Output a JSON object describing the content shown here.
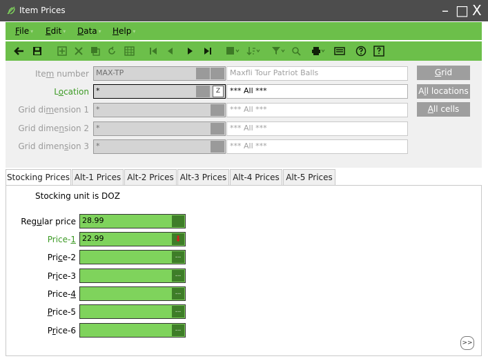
{
  "window": {
    "title": "Item Prices",
    "icon": "app-leaf-icon",
    "minimize": "–",
    "maximize": "□",
    "close": "X"
  },
  "menu": {
    "items": [
      {
        "pre": "",
        "ul": "F",
        "post": "ile"
      },
      {
        "pre": "",
        "ul": "E",
        "post": "dit"
      },
      {
        "pre": "",
        "ul": "D",
        "post": "ata"
      },
      {
        "pre": "",
        "ul": "H",
        "post": "elp"
      }
    ],
    "caret": "▾"
  },
  "toolbar": {
    "icons": [
      "back-arrow-icon",
      "save-icon",
      "add-icon",
      "delete-icon",
      "copy-icon",
      "refresh-icon",
      "grid-icon",
      "first-record-icon",
      "previous-record-icon",
      "next-record-icon",
      "last-record-icon",
      "layout-icon",
      "sort-icon",
      "filter-icon",
      "search-icon",
      "print-icon",
      "export-icon",
      "help-icon",
      "about-icon"
    ]
  },
  "form": {
    "item_number": {
      "pre": "Ite",
      "ul": "m",
      "post": " number",
      "value": "MAX-TP",
      "description": "Maxfli Tour Patriot Balls"
    },
    "location": {
      "pre": "L",
      "ul": "o",
      "post": "cation",
      "value": "*",
      "button": "Z",
      "description": "*** All ***"
    },
    "grid_dim_1": {
      "pre": "Grid di",
      "ul": "m",
      "post": "ension 1",
      "value": "*",
      "description": "*** All ***"
    },
    "grid_dim_2": {
      "pre": "Grid dime",
      "ul": "n",
      "post": "sion 2",
      "value": "*",
      "description": "*** All ***"
    },
    "grid_dim_3": {
      "pre": "Grid dimen",
      "ul": "s",
      "post": "ion 3",
      "value": "*",
      "description": "*** All ***"
    }
  },
  "side_buttons": {
    "grid": {
      "ul": "G",
      "post": "rid"
    },
    "all_locations": {
      "pre": "A",
      "ul": "l",
      "post": "l locations"
    },
    "all_cells": {
      "ul": "A",
      "post": "ll cells"
    }
  },
  "tabs": [
    "Stocking Prices",
    "Alt-1 Prices",
    "Alt-2 Prices",
    "Alt-3 Prices",
    "Alt-4 Prices",
    "Alt-5 Prices"
  ],
  "stocking": {
    "unit_text": "Stocking unit is DOZ",
    "rows": [
      {
        "pre": "Reg",
        "ul": "u",
        "post": "lar price",
        "value": "28.99",
        "button": ""
      },
      {
        "pre": "Price-",
        "ul": "1",
        "post": "",
        "value": "22.99",
        "button": "⬇"
      },
      {
        "pre": "Pri",
        "ul": "c",
        "post": "e-2",
        "value": "",
        "button": "..."
      },
      {
        "pre": "Pr",
        "ul": "i",
        "post": "ce-3",
        "value": "",
        "button": "..."
      },
      {
        "pre": "Price-",
        "ul": "4",
        "post": "",
        "value": "",
        "button": "..."
      },
      {
        "pre": "",
        "ul": "P",
        "post": "rice-5",
        "value": "",
        "button": "..."
      },
      {
        "pre": "P",
        "ul": "r",
        "post": "ice-6",
        "value": "",
        "button": "..."
      }
    ],
    "corner_button": ">>"
  },
  "colors": {
    "title_bar": "#4d4d4d",
    "menu_green": "#6cbf4a",
    "input_green": "#7fd35c",
    "active_label_green": "#3c9a24",
    "side_button_gray": "#9e9e9e"
  }
}
